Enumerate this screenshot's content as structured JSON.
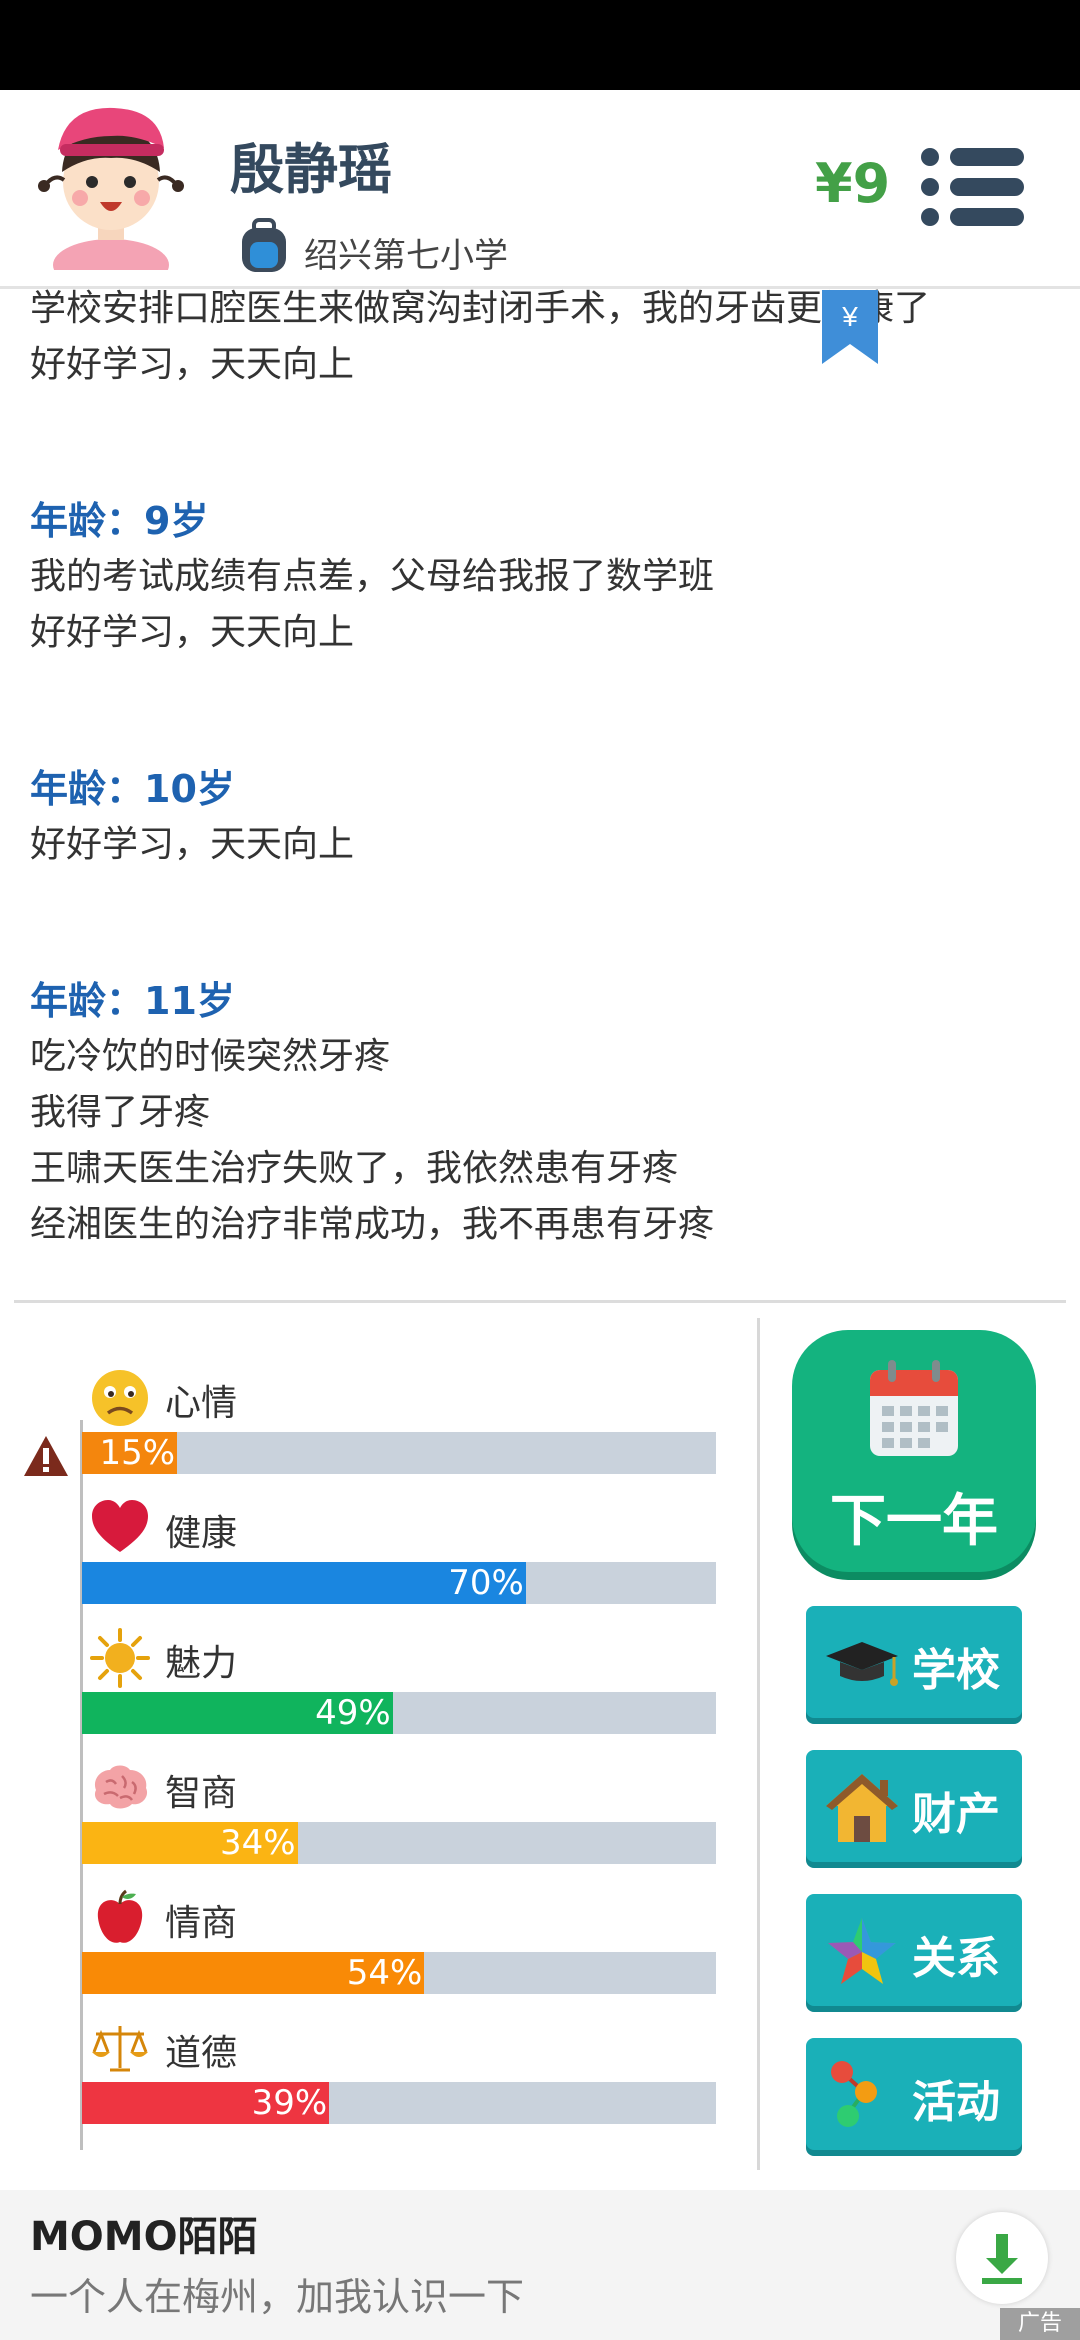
{
  "header": {
    "name": "殷静瑶",
    "school": "绍兴第七小学",
    "money": "¥9",
    "bookmark_symbol": "¥"
  },
  "log": {
    "entries": [
      {
        "age": "",
        "lines": [
          "学校安排口腔医生来做窝沟封闭手术，我的牙齿更健康了",
          "好好学习，天天向上"
        ]
      },
      {
        "age": "年龄：9岁",
        "lines": [
          "我的考试成绩有点差，父母给我报了数学班",
          "好好学习，天天向上"
        ]
      },
      {
        "age": "年龄：10岁",
        "lines": [
          "好好学习，天天向上"
        ]
      },
      {
        "age": "年龄：11岁",
        "lines": [
          "吃冷饮的时候突然牙疼",
          "我得了牙疼",
          "王啸天医生治疗失败了，我依然患有牙疼",
          "经湘医生的治疗非常成功，我不再患有牙疼"
        ]
      }
    ]
  },
  "stats": [
    {
      "label": "心情",
      "value": "15%",
      "percent": 15,
      "color": "#f4860d",
      "icon": "sad-face-icon"
    },
    {
      "label": "健康",
      "value": "70%",
      "percent": 70,
      "color": "#1a86e0",
      "icon": "heart-icon"
    },
    {
      "label": "魅力",
      "value": "49%",
      "percent": 49,
      "color": "#10b45d",
      "icon": "sun-icon"
    },
    {
      "label": "智商",
      "value": "34%",
      "percent": 34,
      "color": "#fbb413",
      "icon": "brain-icon"
    },
    {
      "label": "情商",
      "value": "54%",
      "percent": 54,
      "color": "#f98a06",
      "icon": "apple-icon"
    },
    {
      "label": "道德",
      "value": "39%",
      "percent": 39,
      "color": "#ee3541",
      "icon": "scales-icon"
    }
  ],
  "buttons": {
    "next_year": "下一年",
    "school": "学校",
    "property": "财产",
    "relations": "关系",
    "activities": "活动"
  },
  "ad": {
    "title": "MOMO陌陌",
    "subtitle": "一个人在梅州，加我认识一下",
    "badge": "广告"
  },
  "colors": {
    "accent_green": "#14b37f",
    "button_teal": "#1ab0b8",
    "age_blue": "#1e62b0",
    "money_green": "#43a047"
  }
}
